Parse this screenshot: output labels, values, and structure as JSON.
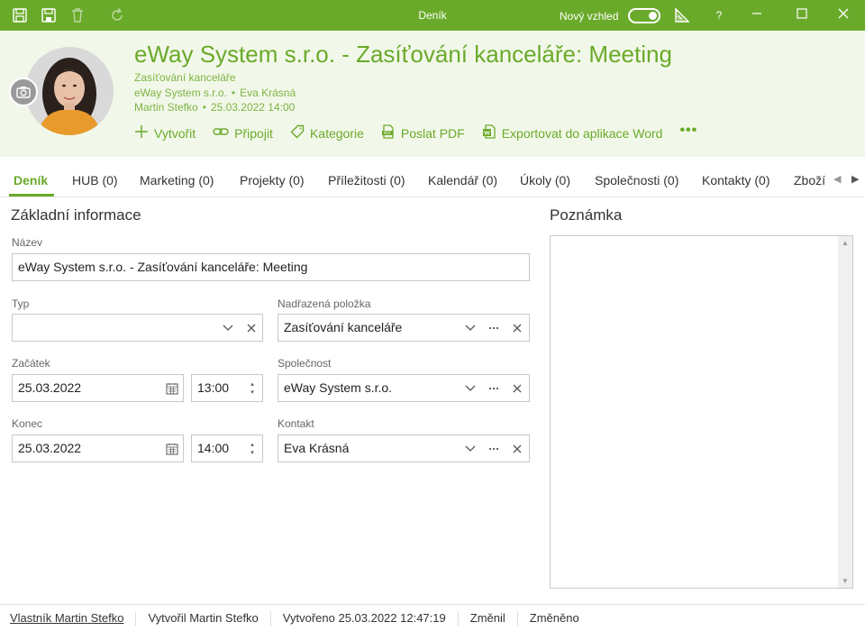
{
  "window": {
    "title": "Deník",
    "new_look_label": "Nový vzhled",
    "help_label": "?"
  },
  "header": {
    "title": "eWay System s.r.o. - Zasíťování kanceláře: Meeting",
    "parent": "Zasíťování kanceláře",
    "company": "eWay System s.r.o.",
    "contact": "Eva Krásná",
    "owner": "Martin Stefko",
    "datetime": "25.03.2022 14:00",
    "separator": "•",
    "actions": [
      {
        "label": "Vytvořit",
        "icon": "plus-icon"
      },
      {
        "label": "Připojit",
        "icon": "link-icon"
      },
      {
        "label": "Kategorie",
        "icon": "tag-icon"
      },
      {
        "label": "Poslat PDF",
        "icon": "pdf-icon"
      },
      {
        "label": "Exportovat do aplikace Word",
        "icon": "word-icon"
      }
    ],
    "more_label": "•••"
  },
  "tabs": [
    {
      "label": "Deník",
      "active": true
    },
    {
      "label": "HUB (0)"
    },
    {
      "label": "Marketing (0)"
    },
    {
      "label": "Projekty (0)"
    },
    {
      "label": "Příležitosti (0)"
    },
    {
      "label": "Kalendář (0)"
    },
    {
      "label": "Úkoly (0)"
    },
    {
      "label": "Společnosti (0)"
    },
    {
      "label": "Kontakty (0)"
    },
    {
      "label": "Zboží"
    }
  ],
  "basic": {
    "title": "Základní informace",
    "name_label": "Název",
    "name_value": "eWay System s.r.o. - Zasíťování kanceláře: Meeting",
    "type_label": "Typ",
    "type_value": "",
    "start_label": "Začátek",
    "start_date": "25.03.2022",
    "start_time": "13:00",
    "end_label": "Konec",
    "end_date": "25.03.2022",
    "end_time": "14:00",
    "parent_label": "Nadřazená položka",
    "parent_value": "Zasíťování kanceláře",
    "company_label": "Společnost",
    "company_value": "eWay System s.r.o.",
    "contact_label": "Kontakt",
    "contact_value": "Eva Krásná"
  },
  "note": {
    "title": "Poznámka"
  },
  "footer": {
    "owner": "Vlastník Martin Stefko",
    "created_by": "Vytvořil Martin Stefko",
    "created_at": "Vytvořeno 25.03.2022 12:47:19",
    "changed_by": "Změnil",
    "changed_at": "Změněno"
  },
  "colors": {
    "accent": "#6aaa2a",
    "header_bg": "#f2f8e9"
  }
}
